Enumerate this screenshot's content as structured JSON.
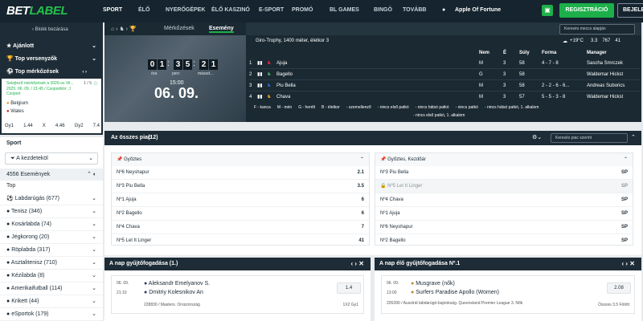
{
  "header": {
    "logo_a": "BET",
    "logo_b": "LABEL",
    "nav": [
      "SPORT",
      "ÉLŐ",
      "NYERŐGÉPEK",
      "ÉLŐ KASZINÓ",
      "E-SPORT",
      "PROMÓ",
      "BL GAMES",
      "BINGÓ",
      "TOVÁBB"
    ],
    "apple": "Apple Of Fortune",
    "register": "REGISZTRÁCIÓ",
    "login": "BEJELE"
  },
  "sidebar": {
    "collapse": "Blokk bezárása",
    "items": [
      "Ajánlott",
      "Top versenyzők",
      "Top mérkőzések"
    ],
    "match_title": "Selejtező mérkőzések a 2026-os Vil...",
    "match_date": "2025. 06. 09. / 21:45 / Csoportkör: J Csoport",
    "page": "1 / 5",
    "teams": [
      "Belgium",
      "Wales"
    ],
    "odds": [
      "Gy1",
      "1.44",
      "X",
      "4.46",
      "Gy2",
      "7.4"
    ]
  },
  "sport": {
    "title": "Sport",
    "filter": "A kezdeteköl",
    "events": "4556 Események",
    "top": "Top",
    "list": [
      "Labdarúgás (677)",
      "Tenisz (346)",
      "Kosárlabda (74)",
      "Jégkorong (20)",
      "Röplabda (317)",
      "Asztalitenisz (710)",
      "Kézilabda (8)",
      "Amerikaifutball (114)",
      "Krikett (44)",
      "eSportok (179)"
    ]
  },
  "hero": {
    "tabs": [
      "Mérkőzések",
      "Esemény"
    ],
    "search": "Keresés meccs alapján",
    "weather": "+19°C",
    "stats": [
      "3.3",
      "767",
      "41"
    ],
    "race": "Giro-Trophy, 1400 méter, életkor 3",
    "countdown": [
      "0",
      "1",
      "3",
      "5",
      "2",
      "1"
    ],
    "units": [
      "óra",
      "perc",
      "másod..."
    ],
    "time": "15:00",
    "date": "06. 09.",
    "cols": [
      "Nem",
      "É",
      "Súly",
      "Forma",
      "Manager"
    ],
    "horses": [
      [
        "1",
        "Ajuja",
        "M",
        "3",
        "58",
        "4 - 7 - 8",
        "Sascha Smrczek"
      ],
      [
        "2",
        "Bagello",
        "G",
        "3",
        "58",
        "",
        "Waldemar Hickst"
      ],
      [
        "3",
        "Piu Bella",
        "M",
        "3",
        "58",
        "2 - 2 - 6 - 6...",
        "Andreas Suborics"
      ],
      [
        "4",
        "Chava",
        "M",
        "3",
        "57",
        "5 - 5 - 3 - 8",
        "Waldemar Hickst"
      ]
    ],
    "legend1": [
      "F - kanca",
      "M - mén",
      "G - herélt",
      "B - életkor",
      "- szemellenző",
      "- nincs első patkó",
      "- nincs hátsó patkó",
      "- nincs patkó",
      "- nincs hátsó patkó, 1. alkalom"
    ],
    "legend2": "- nincs első patkó, 1. alkalom"
  },
  "markets": {
    "title": "Az összes piac",
    "count": "(12)",
    "search": "Keresés piac szerint",
    "left_title": "Győztes",
    "left": [
      [
        "Nº6 Neyshapur",
        "2.1"
      ],
      [
        "Nº3 Piu Bella",
        "3.5"
      ],
      [
        "Nº1 Ajuja",
        "6"
      ],
      [
        "Nº2 Bagello",
        "6"
      ],
      [
        "Nº4 Chava",
        "7"
      ],
      [
        "Nº5 Let It Linger",
        "41"
      ]
    ],
    "right_title": "Győztes, Kezdőár",
    "right": [
      [
        "Nº3 Piu Bella",
        "SP"
      ],
      [
        "Nº5 Let It Linger",
        "SP"
      ],
      [
        "Nº4 Chava",
        "SP"
      ],
      [
        "Nº1 Ajuja",
        "SP"
      ],
      [
        "Nº6 Neyshapur",
        "SP"
      ],
      [
        "Nº2 Bagello",
        "SP"
      ]
    ]
  },
  "acc1": {
    "title": "A nap gyűjtőfogadása (1.)",
    "date": "06. 09.",
    "time": "21:10",
    "p1": "Aleksandr Emelyanov S.",
    "p2": "Dmitriy Kolesnikov An",
    "odd": "1.4",
    "league": "228830 / Masters. Oroszország",
    "bet": "1X2 Gy1"
  },
  "acc2": {
    "title": "A nap élő gyűjtőfogadása Nº.1",
    "date": "06. 09.",
    "time": "13:00",
    "p1": "Musgrave (nők)",
    "p2": "Surfers Paradise Apollo (Women)",
    "odd": "2.08",
    "league": "205390 / Ausztrál labdarúgó-bajnokság. Queensland Premier League 3. Nők",
    "bet": "Összes 3.5 Fölött"
  }
}
